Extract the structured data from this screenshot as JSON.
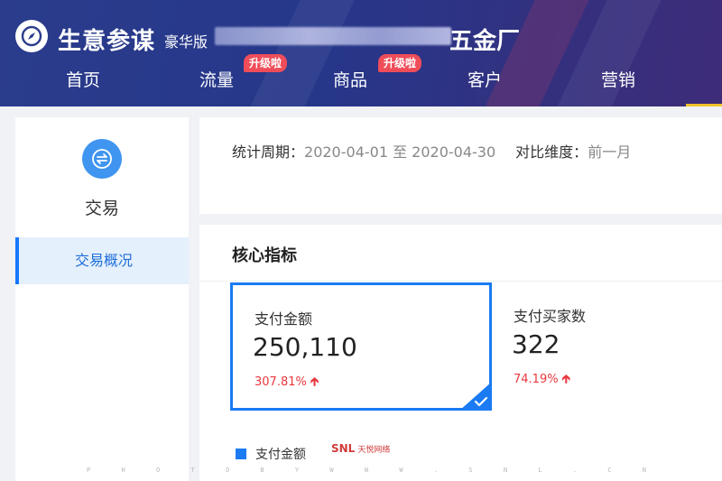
{
  "header": {
    "app_title": "生意参谋",
    "edition": "豪华版",
    "shop_name_suffix": "五金厂",
    "logo_icon": "compass-icon",
    "nav": [
      {
        "label": "首页",
        "badge": ""
      },
      {
        "label": "流量",
        "badge": "升级啦"
      },
      {
        "label": "商品",
        "badge": "升级啦"
      },
      {
        "label": "客户",
        "badge": ""
      },
      {
        "label": "营销",
        "badge": ""
      }
    ]
  },
  "sidebar": {
    "section_title": "交易",
    "section_icon": "exchange-icon",
    "items": [
      {
        "label": "交易概况",
        "active": true
      }
    ]
  },
  "filter": {
    "period_label": "统计周期：",
    "period_value": "2020-04-01 至 2020-04-30",
    "compare_label": "对比维度：",
    "compare_value": "前一月"
  },
  "metrics": {
    "title": "核心指标",
    "cards": [
      {
        "label": "支付金额",
        "value": "250,110",
        "change": "307.81%",
        "trend": "up",
        "selected": true
      },
      {
        "label": "支付买家数",
        "value": "322",
        "change": "74.19%",
        "trend": "up",
        "selected": false
      }
    ],
    "legend": "支付金额"
  },
  "watermark": {
    "logo": "SNL",
    "logo_sub": "天悦网络",
    "letters": [
      "P",
      "H",
      "O",
      "T",
      "O",
      "B",
      "Y",
      "W",
      "W",
      "W",
      ".",
      "S",
      "N",
      "L",
      ".",
      "C",
      "N"
    ]
  },
  "colors": {
    "accent": "#1a7bf2",
    "badge": "#ef4d5a",
    "up": "#e8383d",
    "header_bg": "#2b3c8c",
    "active_underline": "#f5c229"
  }
}
